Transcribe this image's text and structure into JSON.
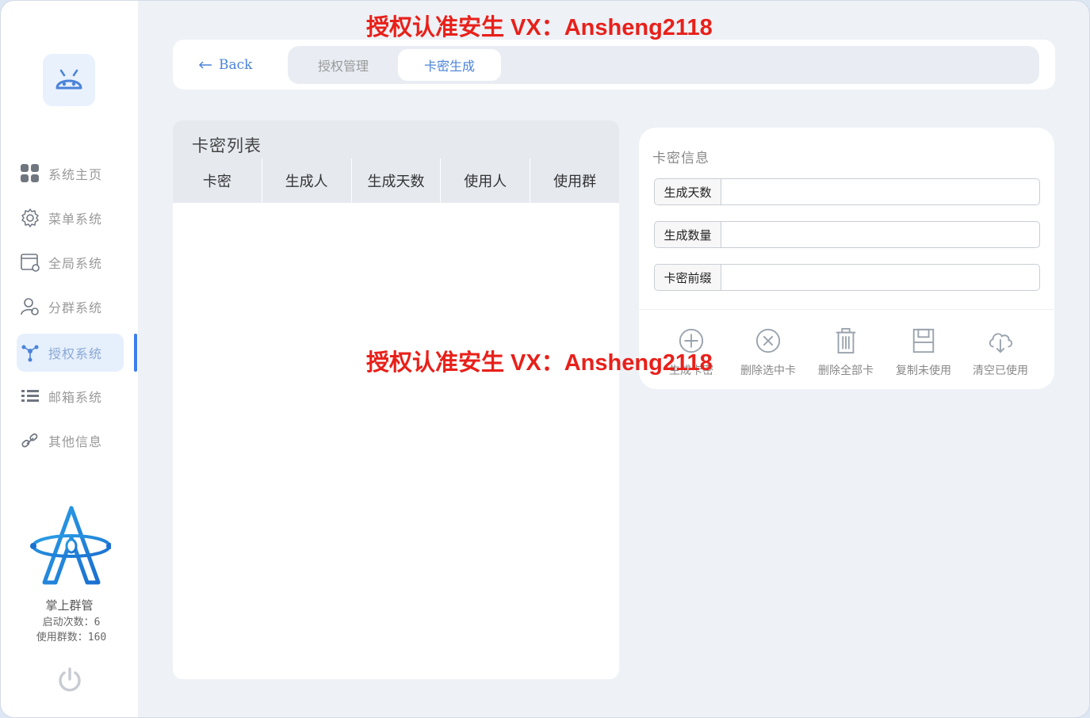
{
  "sidebar": {
    "items": [
      {
        "label": "系统主页",
        "icon": "grid-icon"
      },
      {
        "label": "菜单系统",
        "icon": "gear-icon"
      },
      {
        "label": "全局系统",
        "icon": "window-settings-icon"
      },
      {
        "label": "分群系统",
        "icon": "user-group-icon"
      },
      {
        "label": "授权系统",
        "icon": "network-icon",
        "active": true
      },
      {
        "label": "邮箱系统",
        "icon": "list-icon"
      },
      {
        "label": "其他信息",
        "icon": "link-icon"
      }
    ],
    "brand_name": "掌上群管",
    "launch_count": "启动次数：6",
    "group_count": "使用群数：160"
  },
  "topbar": {
    "back_label": "Back",
    "tabs": [
      {
        "label": "授权管理",
        "active": false
      },
      {
        "label": "卡密生成",
        "active": true
      }
    ]
  },
  "list": {
    "title": "卡密列表",
    "columns": [
      "卡密",
      "生成人",
      "生成天数",
      "使用人",
      "使用群"
    ]
  },
  "info": {
    "title": "卡密信息",
    "fields": [
      {
        "label": "生成天数",
        "value": ""
      },
      {
        "label": "生成数量",
        "value": ""
      },
      {
        "label": "卡密前缀",
        "value": ""
      }
    ],
    "actions": [
      {
        "label": "生成卡密",
        "icon": "plus-circle-icon"
      },
      {
        "label": "删除选中卡",
        "icon": "close-circle-icon"
      },
      {
        "label": "删除全部卡",
        "icon": "trash-icon"
      },
      {
        "label": "复制未使用",
        "icon": "save-icon"
      },
      {
        "label": "清空已使用",
        "icon": "cloud-download-icon"
      }
    ]
  },
  "watermark": "授权认准安生 VX：Ansheng2118",
  "colors": {
    "accent": "#4b83d8",
    "active_bar": "#3c7ef0",
    "watermark": "#e8201a",
    "icon_gray": "#9aa3ad"
  }
}
